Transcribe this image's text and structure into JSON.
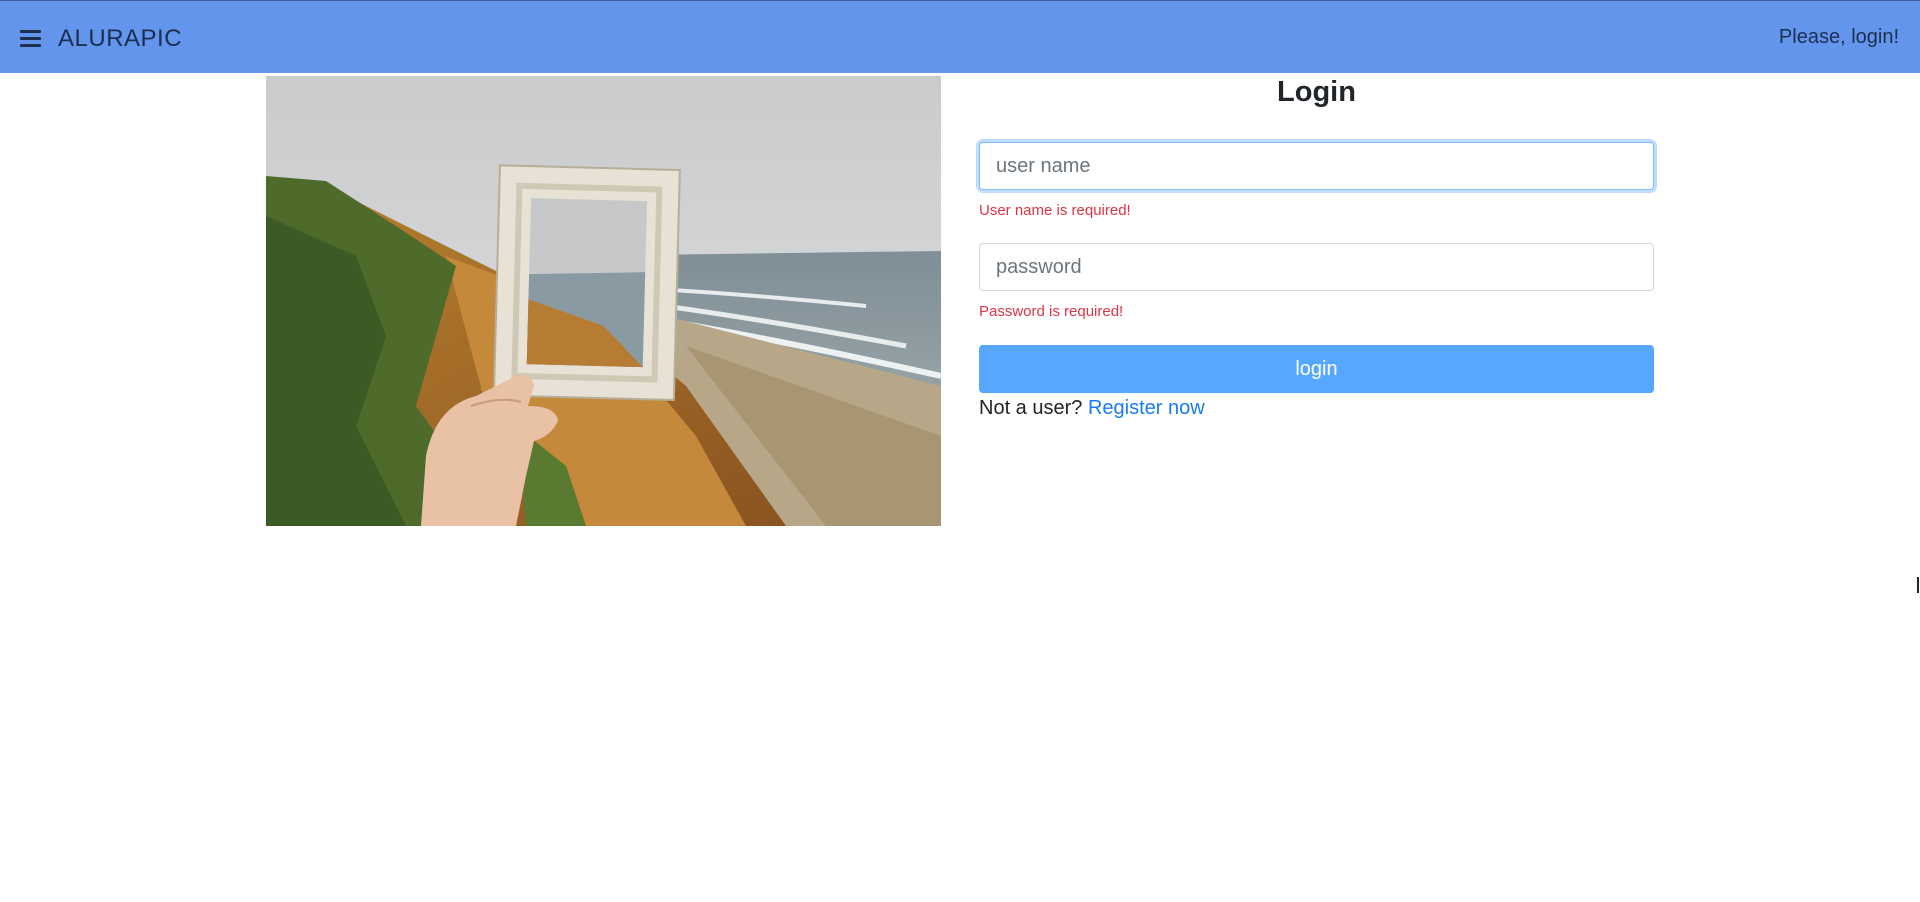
{
  "navbar": {
    "menu_icon": "hamburger-menu-icon",
    "brand": "ALURAPIC",
    "user_status": "Please, login!",
    "background_color": "#6495ed"
  },
  "hero_image": {
    "description_icon": "photo-frame-over-coastal-cliff-image"
  },
  "form": {
    "title": "Login",
    "username": {
      "value": "",
      "placeholder": "user name",
      "error": "User name is required!"
    },
    "password": {
      "value": "",
      "placeholder": "password",
      "error": "Password is required!"
    },
    "submit_label": "login",
    "register_prompt": "Not a user?",
    "register_link": "Register now"
  },
  "colors": {
    "accent": "#57a7ff",
    "error": "#dc3545",
    "link": "#1a7cf0"
  }
}
